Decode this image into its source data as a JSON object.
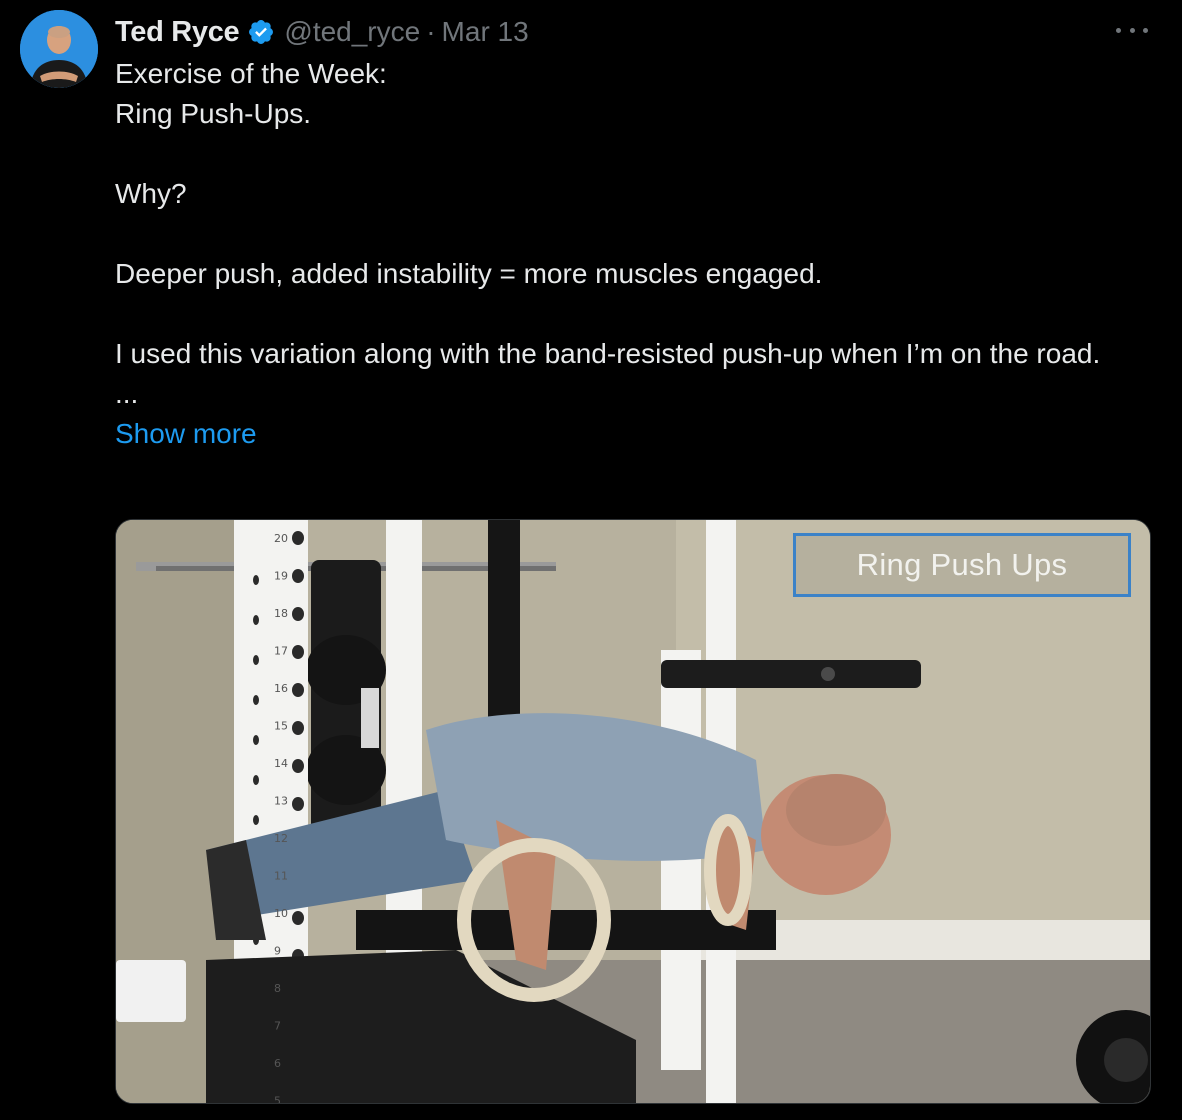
{
  "author": {
    "name": "Ted Ryce",
    "handle": "@ted_ryce",
    "separator": "·",
    "date": "Mar 13",
    "verified": true
  },
  "tweet": {
    "lines": [
      "Exercise of the Week:",
      "Ring Push-Ups.",
      "Why?",
      "Deeper push, added instability = more muscles engaged.",
      "I used this variation along with the band-resisted push-up when I’m on the road.",
      "..."
    ],
    "show_more": "Show more"
  },
  "media": {
    "overlay_title": "Ring Push Ups",
    "rack_numbers": [
      "20",
      "19",
      "18",
      "17",
      "16",
      "15",
      "14",
      "13",
      "12",
      "11",
      "10",
      "9",
      "8",
      "7",
      "6",
      "5"
    ]
  },
  "icons": {
    "more": "more-options-icon",
    "verified": "verified-badge-icon"
  },
  "colors": {
    "background": "#000000",
    "text": "#e7e9ea",
    "muted": "#71767b",
    "link": "#1d9bf0",
    "verified": "#1d9bf0",
    "overlay_border": "#3b82c8"
  }
}
